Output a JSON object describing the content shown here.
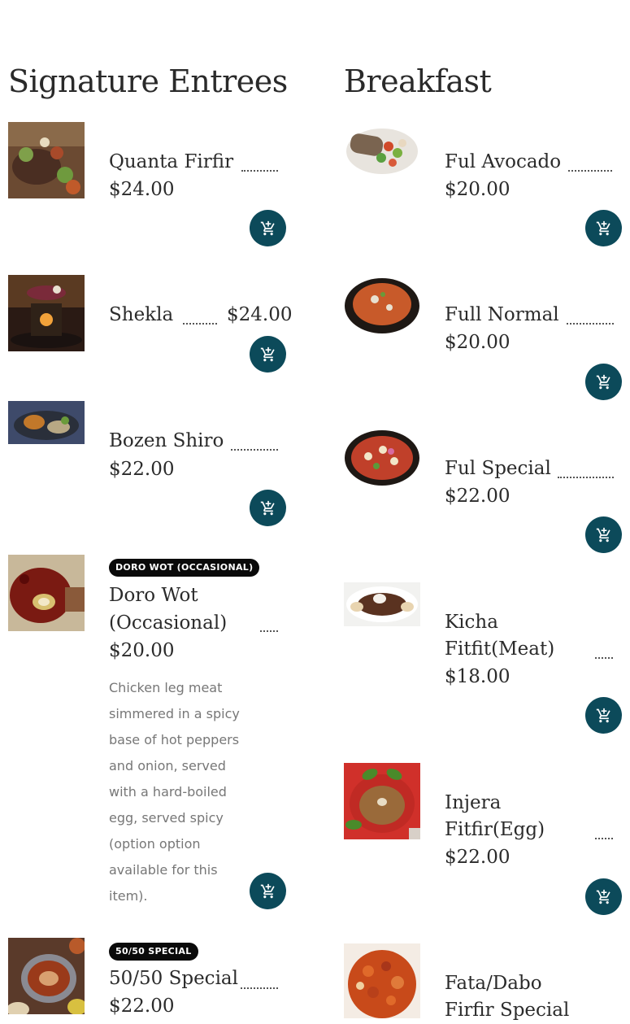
{
  "sections": {
    "signature": {
      "title": "Signature Entrees",
      "items": [
        {
          "name": "Quanta Firfir",
          "price": "$24.00",
          "image": "quanta-firfir-photo"
        },
        {
          "name": "Shekla",
          "price": "$24.00",
          "image": "shekla-photo"
        },
        {
          "name": "Bozen Shiro",
          "price": "$22.00",
          "image": "bozen-shiro-photo"
        },
        {
          "badge": "DORO WOT (OCCASIONAL)",
          "name_line1": "Doro Wot",
          "name_line2": "(Occasional)",
          "price": "$20.00",
          "description": "Chicken leg meat simmered in a spicy base of hot peppers and onion, served with a hard-boiled egg, served spicy (option option available for this item).",
          "image": "doro-wot-photo"
        },
        {
          "badge": "50/50 SPECIAL",
          "name": "50/50 Special",
          "price": "$22.00",
          "image": "fifty-fifty-photo"
        }
      ]
    },
    "breakfast": {
      "title": "Breakfast",
      "items": [
        {
          "name": "Ful Avocado",
          "price": "$20.00",
          "image": "ful-avocado-photo"
        },
        {
          "name": "Full Normal",
          "price": "$20.00",
          "image": "full-normal-photo"
        },
        {
          "name": "Ful Special",
          "price": "$22.00",
          "image": "ful-special-photo"
        },
        {
          "name_line1": "Kicha",
          "name_line2": "Fitfit(Meat)",
          "price": "$18.00",
          "image": "kicha-fitfit-photo"
        },
        {
          "name_line1": "Injera",
          "name_line2": "Fitfir(Egg)",
          "price": "$22.00",
          "image": "injera-fitfir-photo"
        },
        {
          "name_line1": "Fata/Dabo",
          "name_line2": "Firfir Special",
          "image": "fata-dabo-photo"
        }
      ]
    }
  },
  "icons": {
    "cart": "add-to-cart-icon"
  },
  "colors": {
    "cart_button": "#0c4a5a",
    "badge": "#0a0a0a",
    "description": "#777777"
  }
}
